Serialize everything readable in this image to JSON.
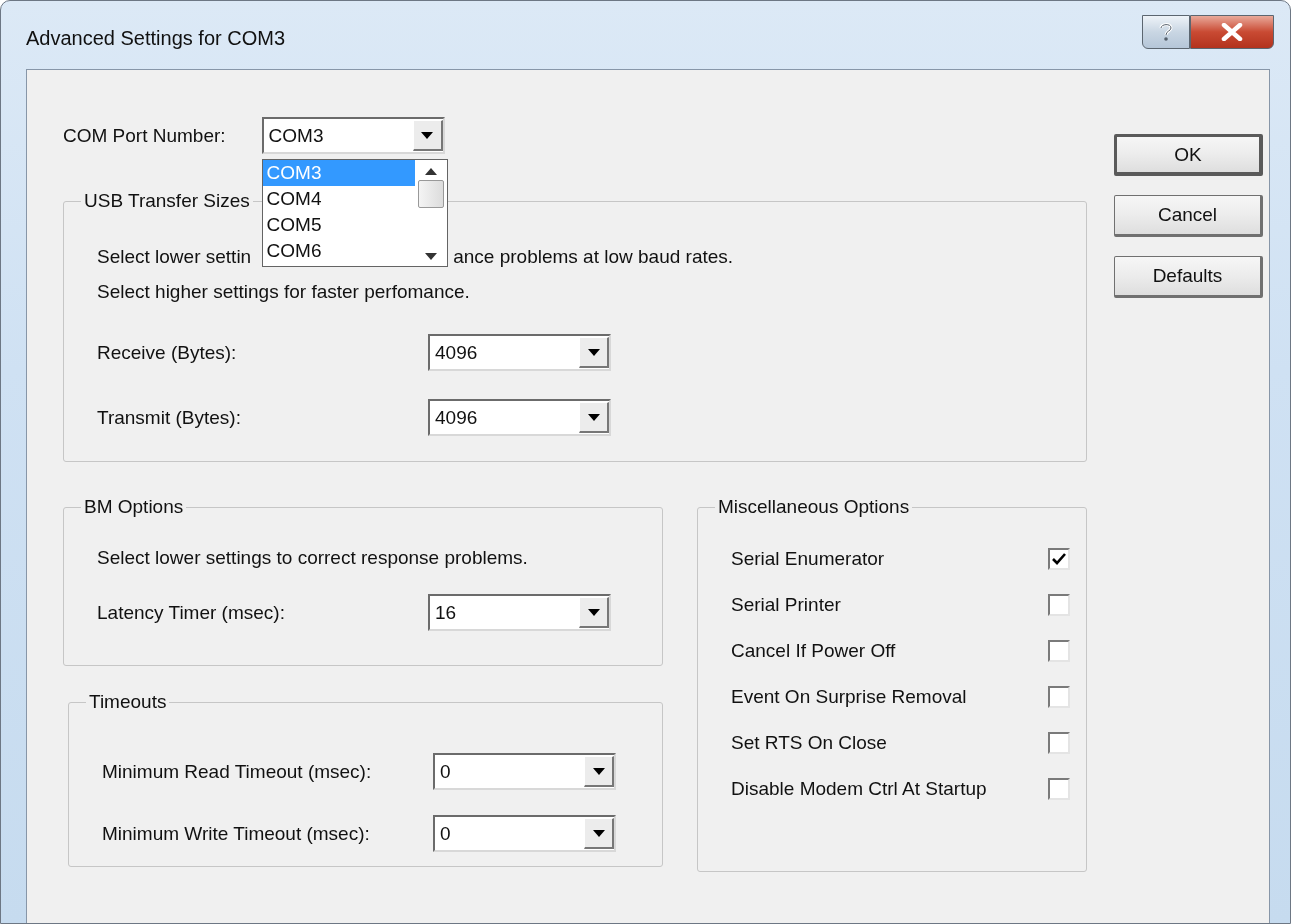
{
  "window": {
    "title": "Advanced Settings for COM3"
  },
  "com_port": {
    "label": "COM Port Number:",
    "value": "COM3",
    "expanded": true,
    "options": [
      {
        "label": "COM3",
        "selected": true
      },
      {
        "label": "COM4",
        "selected": false
      },
      {
        "label": "COM5",
        "selected": false
      },
      {
        "label": "COM6",
        "selected": false
      }
    ]
  },
  "usb_transfer_sizes": {
    "title": "USB Transfer Sizes",
    "note_line_1_parts": [
      "Select lower settin",
      "ance problems at low baud rates."
    ],
    "note_line_2": "Select higher settings for faster perfomance.",
    "fields": [
      {
        "label": "Receive (Bytes):",
        "value": "4096"
      },
      {
        "label": "Transmit (Bytes):",
        "value": "4096"
      }
    ]
  },
  "bm_options": {
    "title": "BM Options",
    "note": "Select lower settings to correct response problems.",
    "fields": [
      {
        "label": "Latency Timer (msec):",
        "value": "16"
      }
    ]
  },
  "timeouts": {
    "title": "Timeouts",
    "fields": [
      {
        "label": "Minimum Read Timeout (msec):",
        "value": "0"
      },
      {
        "label": "Minimum Write Timeout (msec):",
        "value": "0"
      }
    ]
  },
  "miscellaneous_options": {
    "title": "Miscellaneous Options",
    "options": [
      {
        "label": "Serial Enumerator",
        "checked": true
      },
      {
        "label": "Serial Printer",
        "checked": false
      },
      {
        "label": "Cancel If Power Off",
        "checked": false
      },
      {
        "label": "Event On Surprise Removal",
        "checked": false
      },
      {
        "label": "Set RTS On Close",
        "checked": false
      },
      {
        "label": "Disable Modem Ctrl At Startup",
        "checked": false
      }
    ]
  },
  "buttons": [
    {
      "label": "OK",
      "default": true
    },
    {
      "label": "Cancel",
      "default": false
    },
    {
      "label": "Defaults",
      "default": false
    }
  ]
}
